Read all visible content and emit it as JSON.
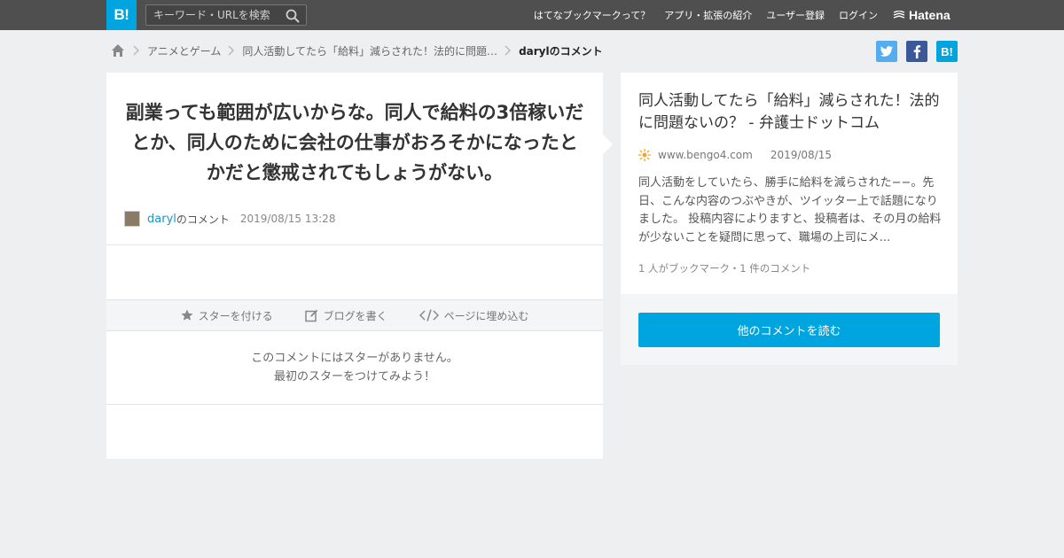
{
  "header": {
    "logo_text": "B!",
    "search_placeholder": "キーワード・URLを検索",
    "nav": [
      "はてなブックマークって？",
      "アプリ・拡張の紹介",
      "ユーザー登録",
      "ログイン"
    ],
    "brand": "Hatena",
    "accent_color": "#00a4de",
    "bar_color": "#4f4f4f"
  },
  "breadcrumb": {
    "items": [
      "アニメとゲーム",
      "同人活動してたら「給料」減らされた！法的に問題…"
    ],
    "current": "darylのコメント"
  },
  "share": {
    "icons": [
      "twitter-icon",
      "facebook-icon",
      "hatena-bookmark-icon"
    ],
    "hatena_label": "B!"
  },
  "comment": {
    "text": "副業っても範囲が広いからな。同人で給料の3倍稼いだとか、同人のために会社の仕事がおろそかになったとかだと懲戒されてもしょうがない。",
    "username": "daryl",
    "suffix": "のコメント",
    "date": "2019/08/15 13:28"
  },
  "actions": {
    "star": "スターを付ける",
    "blog": "ブログを書く",
    "embed": "ページに埋め込む"
  },
  "stars": {
    "line1": "このコメントにはスターがありません。",
    "line2": "最初のスターをつけてみよう！"
  },
  "article": {
    "title": "同人活動してたら「給料」減らされた！法的に問題ないの？ - 弁護士ドットコム",
    "domain": "www.bengo4.com",
    "date": "2019/08/15",
    "description": "同人活動をしていたら、勝手に給料を減らされた−−。先日、こんな内容のつぶやきが、ツイッター上で話題になりました。 投稿内容によりますと、投稿者は、その月の給料が少ないことを疑問に思って、職場の上司にメ...",
    "counts": "1 人がブックマーク・1 件のコメント",
    "read_more": "他のコメントを読む"
  }
}
